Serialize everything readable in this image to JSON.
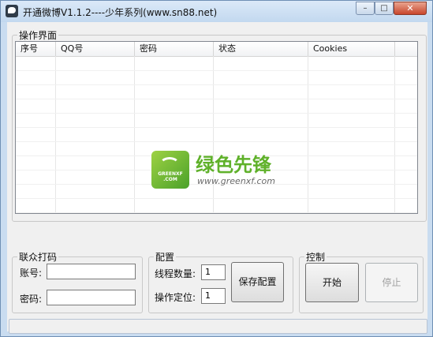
{
  "window": {
    "title": "开通微博V1.1.2----少年系列(www.sn88.net)"
  },
  "operations": {
    "legend": "操作界面",
    "columns": [
      "序号",
      "QQ号",
      "密码",
      "状态",
      "Cookies"
    ],
    "rows": []
  },
  "watermark": {
    "logo_text_1": "GREENXF",
    "logo_text_2": ".COM",
    "name": "绿色先锋",
    "url": "www.greenxf.com"
  },
  "captcha": {
    "legend": "联众打码",
    "account_label": "账号:",
    "account_value": "",
    "password_label": "密码:",
    "password_value": ""
  },
  "config": {
    "legend": "配置",
    "threads_label": "线程数量:",
    "threads_value": "1",
    "position_label": "操作定位:",
    "position_value": "1",
    "save_label": "保存配置"
  },
  "control": {
    "legend": "控制",
    "start_label": "开始",
    "stop_label": "停止"
  },
  "status_bar": {
    "text": ""
  },
  "colors": {
    "frame": "#c9dcf0",
    "client": "#f0f0f0",
    "watermark_green": "#5fb12a"
  }
}
